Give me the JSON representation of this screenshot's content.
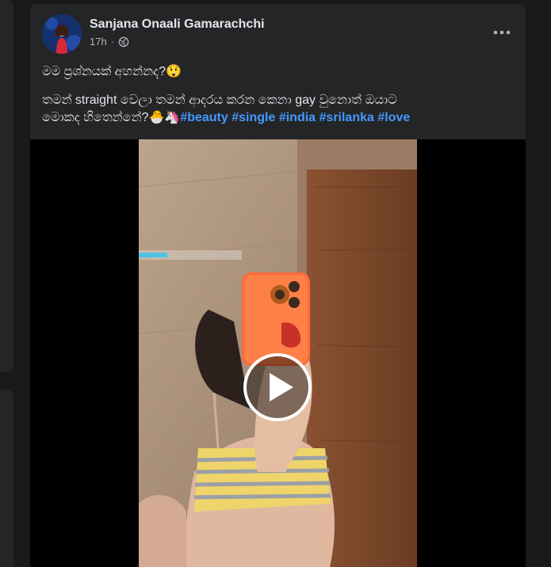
{
  "post": {
    "author": "Sanjana Onaali Gamarachchi",
    "time": "17h",
    "audience_icon": "globe-icon",
    "more_icon": "more-options-icon",
    "line1": "මම ප්‍රශ්නයක් අහන්නද?😲",
    "line2": "තමන්  straight වෙලා තමන් ආදරය කරන කෙනා gay වුනොත් ඔයාට",
    "line3": "මොකද හිතෙන්නේ?🐣🦄",
    "hashtags": [
      "#beauty",
      "#single",
      "#india",
      "#srilanka",
      "#love"
    ]
  },
  "video": {
    "play_icon": "play-icon"
  },
  "colors": {
    "background": "#18191a",
    "card": "#242526",
    "text": "#e4e6eb",
    "secondary": "#b0b3b8",
    "link": "#4599ff"
  }
}
